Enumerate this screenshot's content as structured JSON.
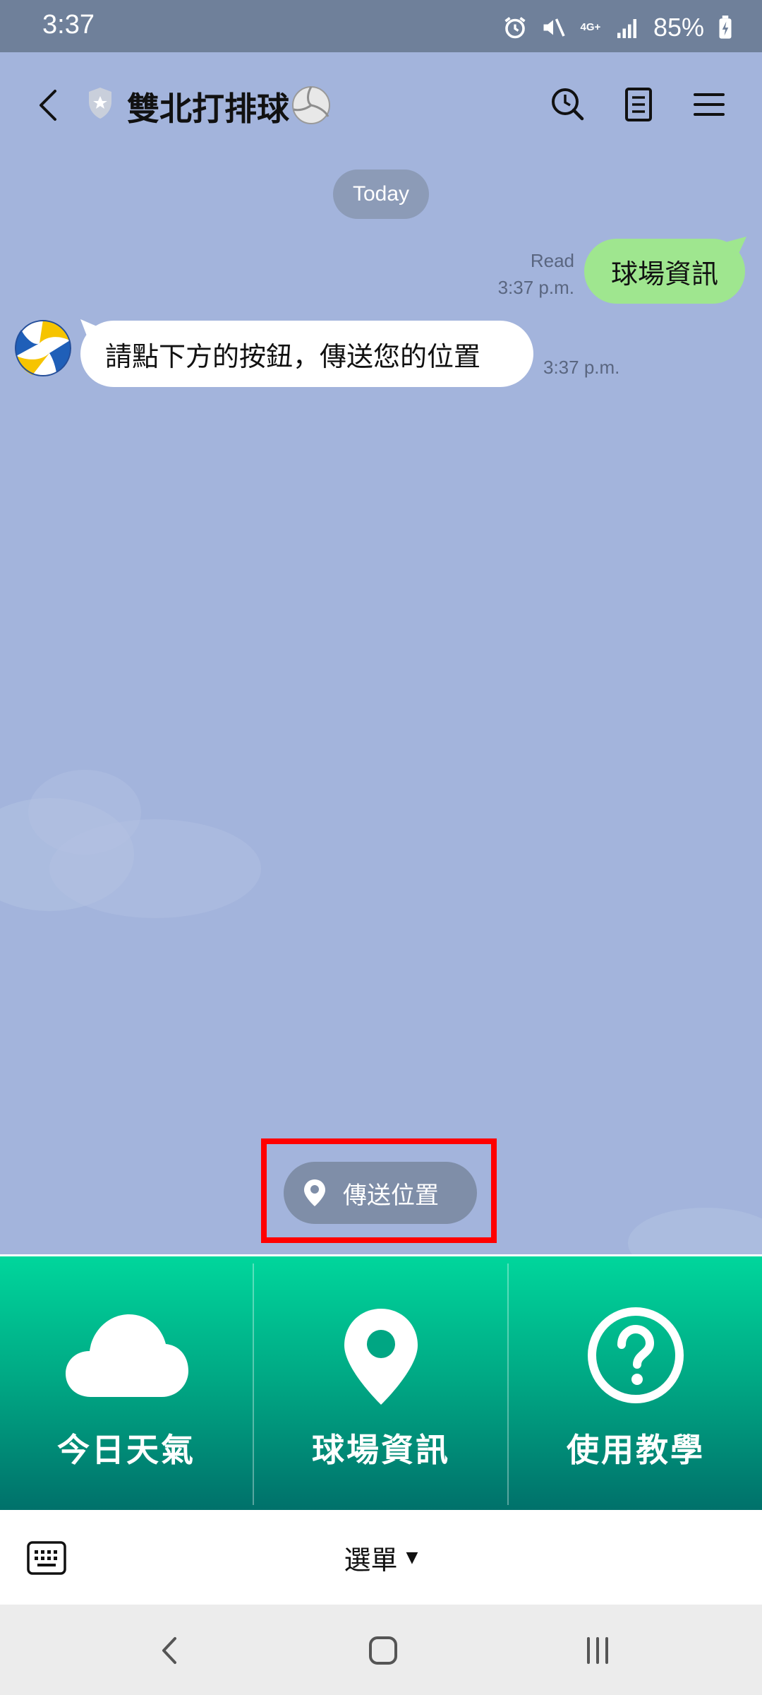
{
  "status": {
    "time": "3:37",
    "network": "4G+",
    "battery": "85%"
  },
  "header": {
    "title": "雙北打排球"
  },
  "chat": {
    "date_divider": "Today",
    "outgoing": {
      "read_label": "Read",
      "time": "3:37 p.m.",
      "text": "球場資訊"
    },
    "incoming": {
      "text": "請點下方的按鈕，傳送您的位置",
      "time": "3:37 p.m."
    }
  },
  "quick_reply": {
    "label": "傳送位置"
  },
  "rich_menu": {
    "items": [
      {
        "label": "今日天氣",
        "icon": "cloud-icon"
      },
      {
        "label": "球場資訊",
        "icon": "location-pin-icon"
      },
      {
        "label": "使用教學",
        "icon": "help-circle-icon"
      }
    ]
  },
  "bottom_bar": {
    "menu_label": "選單"
  },
  "colors": {
    "chat_background": "#A3B4DC",
    "outgoing_bubble": "#9FE68F",
    "rich_menu_top": "#00D69C",
    "rich_menu_bottom": "#00706A",
    "highlight": "#FF0000"
  }
}
